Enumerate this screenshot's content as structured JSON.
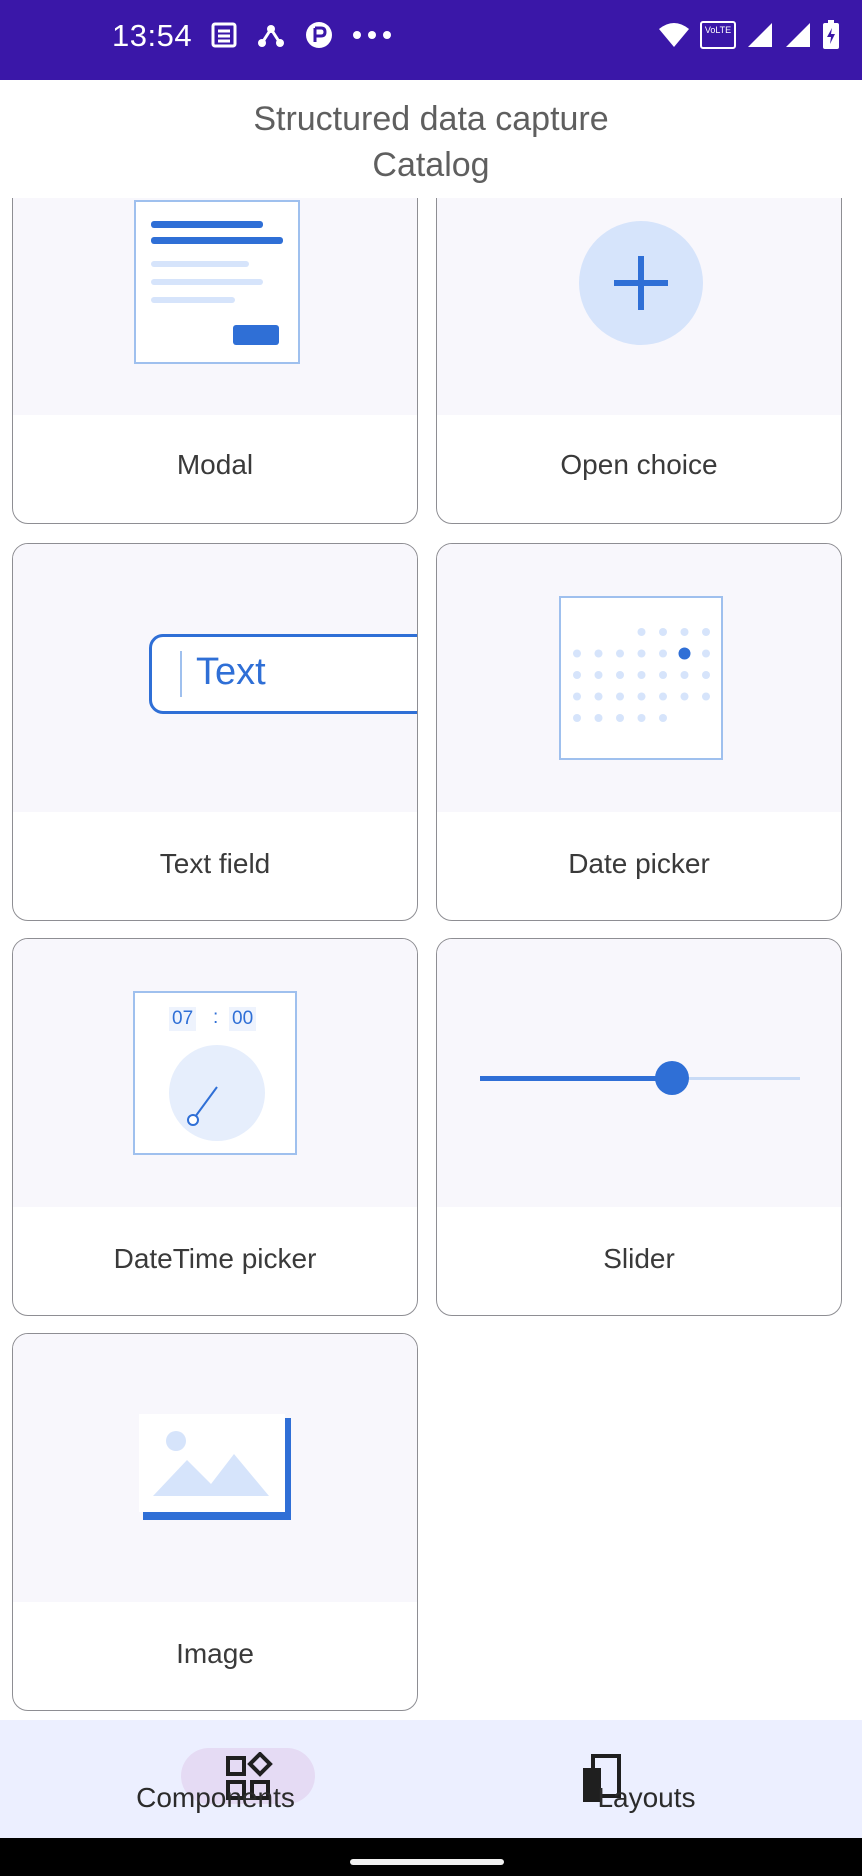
{
  "status_bar": {
    "time": "13:54",
    "left_icons": [
      "news-icon",
      "network-icon",
      "app-icon",
      "more-dots-icon"
    ],
    "right_icons": [
      "wifi-icon",
      "volte-icon",
      "signal-icon",
      "signal-icon",
      "battery-icon"
    ],
    "volte_text": "VoLTE"
  },
  "app_bar": {
    "title_line1": "Structured data capture",
    "title_line2": "Catalog"
  },
  "cards": [
    {
      "label": "Modal",
      "icon": "modal-illustration"
    },
    {
      "label": "Open choice",
      "icon": "plus-icon"
    },
    {
      "label": "Text field",
      "icon": "text-field-illustration",
      "preview_text": "Text"
    },
    {
      "label": "Date picker",
      "icon": "date-picker-illustration"
    },
    {
      "label": "DateTime picker",
      "icon": "clock-illustration",
      "time_hours": "07",
      "time_sep": ":",
      "time_minutes": "00"
    },
    {
      "label": "Slider",
      "icon": "slider-illustration",
      "slider_value": 0.6
    },
    {
      "label": "Image",
      "icon": "image-illustration"
    }
  ],
  "bottom_nav": {
    "components_label": "Components",
    "layouts_label": "Layouts",
    "active": "Components"
  },
  "colors": {
    "status_bar": "#3a17a8",
    "accent": "#2f6fd6",
    "light_accent": "#d6e4fb",
    "preview_bg": "#f8f7fc",
    "nav_bg": "#ecefff",
    "nav_pill": "#e5dbf4"
  }
}
